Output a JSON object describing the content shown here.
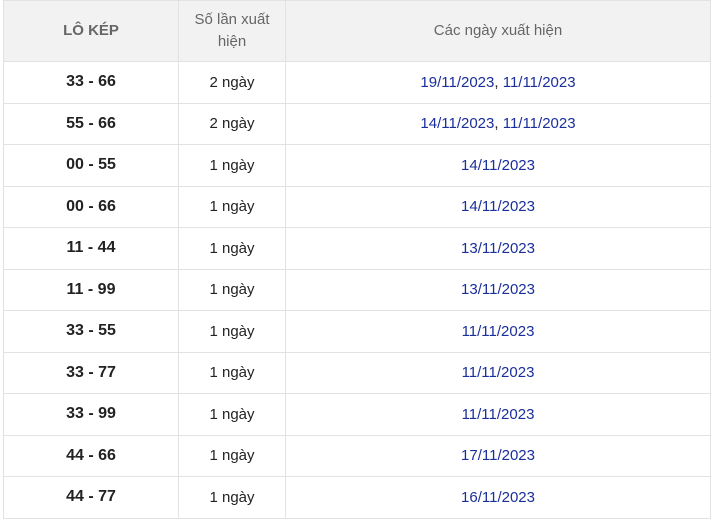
{
  "headers": {
    "col1": "LÔ KÉP",
    "col2": "Số lần xuất hiện",
    "col3": "Các ngày xuất hiện"
  },
  "rows": [
    {
      "pair": "33 - 66",
      "count": "2 ngày",
      "dates": [
        "19/11/2023",
        "11/11/2023"
      ]
    },
    {
      "pair": "55 - 66",
      "count": "2 ngày",
      "dates": [
        "14/11/2023",
        "11/11/2023"
      ]
    },
    {
      "pair": "00 - 55",
      "count": "1 ngày",
      "dates": [
        "14/11/2023"
      ]
    },
    {
      "pair": "00 - 66",
      "count": "1 ngày",
      "dates": [
        "14/11/2023"
      ]
    },
    {
      "pair": "11 - 44",
      "count": "1 ngày",
      "dates": [
        "13/11/2023"
      ]
    },
    {
      "pair": "11 - 99",
      "count": "1 ngày",
      "dates": [
        "13/11/2023"
      ]
    },
    {
      "pair": "33 - 55",
      "count": "1 ngày",
      "dates": [
        "11/11/2023"
      ]
    },
    {
      "pair": "33 - 77",
      "count": "1 ngày",
      "dates": [
        "11/11/2023"
      ]
    },
    {
      "pair": "33 - 99",
      "count": "1 ngày",
      "dates": [
        "11/11/2023"
      ]
    },
    {
      "pair": "44 - 66",
      "count": "1 ngày",
      "dates": [
        "17/11/2023"
      ]
    },
    {
      "pair": "44 - 77",
      "count": "1 ngày",
      "dates": [
        "16/11/2023"
      ]
    }
  ],
  "separator": ", ",
  "colors": {
    "date_link": "#1a2e9c",
    "header_bg": "#f2f2f2",
    "border": "#e2e2e2"
  }
}
